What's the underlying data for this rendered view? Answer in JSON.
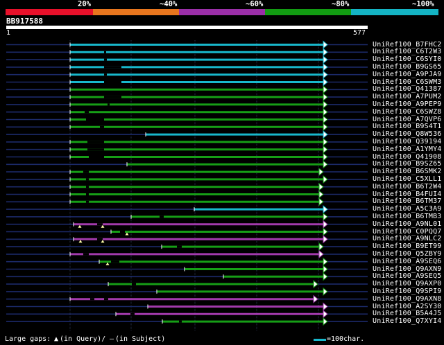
{
  "score_bar": {
    "labels": [
      "20%",
      "~40%",
      "~60%",
      "~80%",
      "~100%"
    ],
    "colors": [
      "#e8102a",
      "#e8761e",
      "#9b2fa8",
      "#129c12",
      "#14b4c4"
    ]
  },
  "query": {
    "id": "BB917588",
    "start": "1",
    "end": "577"
  },
  "hits": [
    {
      "name": "UniRef100_B7FHC2",
      "color": "#18b8cc"
    },
    {
      "name": "UniRef100_C6T2W3",
      "color": "#18b8cc"
    },
    {
      "name": "UniRef100_C6SYI0",
      "color": "#18b8cc"
    },
    {
      "name": "UniRef100_B9GS65",
      "color": "#18b8cc"
    },
    {
      "name": "UniRef100_A9PJA9",
      "color": "#18b8cc"
    },
    {
      "name": "UniRef100_C6SWM3",
      "color": "#18b8cc"
    },
    {
      "name": "UniRef100_Q41387",
      "color": "#169e16"
    },
    {
      "name": "UniRef100_A7PUM2",
      "color": "#169e16"
    },
    {
      "name": "UniRef100_A9PEP9",
      "color": "#169e16"
    },
    {
      "name": "UniRef100_C6SWZ8",
      "color": "#169e16"
    },
    {
      "name": "UniRef100_A7QVP6",
      "color": "#169e16"
    },
    {
      "name": "UniRef100_B9S4T1",
      "color": "#169e16"
    },
    {
      "name": "UniRef100_Q8W536",
      "color": "#18b8cc"
    },
    {
      "name": "UniRef100_Q39194",
      "color": "#169e16"
    },
    {
      "name": "UniRef100_A1YMY4",
      "color": "#169e16"
    },
    {
      "name": "UniRef100_Q41908",
      "color": "#169e16"
    },
    {
      "name": "UniRef100_B9SZ65",
      "color": "#169e16"
    },
    {
      "name": "UniRef100_B6SMK2",
      "color": "#169e16"
    },
    {
      "name": "UniRef100_C5XLL1",
      "color": "#169e16"
    },
    {
      "name": "UniRef100_B6T2W4",
      "color": "#169e16"
    },
    {
      "name": "UniRef100_B4FUI4",
      "color": "#169e16"
    },
    {
      "name": "UniRef100_B6TM37",
      "color": "#169e16"
    },
    {
      "name": "UniRef100_A5C3A9",
      "color": "#18b8cc"
    },
    {
      "name": "UniRef100_B6TMB3",
      "color": "#169e16"
    },
    {
      "name": "UniRef100_A9NL01",
      "color": "#a23aac"
    },
    {
      "name": "UniRef100_C0PQQ7",
      "color": "#169e16"
    },
    {
      "name": "UniRef100_A9NLC2",
      "color": "#a23aac"
    },
    {
      "name": "UniRef100_B9ET99",
      "color": "#169e16"
    },
    {
      "name": "UniRef100_Q5ZBY9",
      "color": "#a23aac"
    },
    {
      "name": "UniRef100_A9SEQ6",
      "color": "#169e16"
    },
    {
      "name": "UniRef100_Q9AXN9",
      "color": "#169e16"
    },
    {
      "name": "UniRef100_A9SEQ5",
      "color": "#169e16"
    },
    {
      "name": "UniRef100_Q9AXP0",
      "color": "#169e16"
    },
    {
      "name": "UniRef100_Q9SPI9",
      "color": "#169e16"
    },
    {
      "name": "UniRef100_Q9AXN8",
      "color": "#a23aac"
    },
    {
      "name": "UniRef100_A2SY30",
      "color": "#a23aac"
    },
    {
      "name": "UniRef100_B5A4J5",
      "color": "#a23aac"
    },
    {
      "name": "UniRef100_Q7XYI4",
      "color": "#169e16"
    }
  ],
  "footer": {
    "gaps_prefix": "Large gaps:",
    "gaps_query": "(in Query)/",
    "gaps_dash": "–",
    "gaps_subject": "(in Subject)",
    "scale_label": "=100char."
  }
}
